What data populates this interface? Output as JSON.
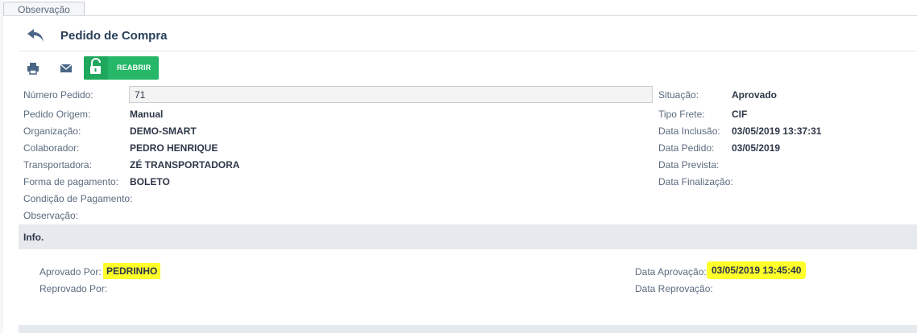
{
  "tab": {
    "label": "Observação"
  },
  "header": {
    "title": "Pedido de Compra"
  },
  "toolbar": {
    "reopen_label": "REABRIR"
  },
  "fields_left": [
    {
      "label": "Número Pedido:",
      "value": "71"
    },
    {
      "label": "Pedido Origem:",
      "value": "Manual"
    },
    {
      "label": "Organização:",
      "value": "DEMO-SMART"
    },
    {
      "label": "Colaborador:",
      "value": "PEDRO HENRIQUE"
    },
    {
      "label": "Transportadora:",
      "value": "ZÉ TRANSPORTADORA"
    },
    {
      "label": "Forma de pagamento:",
      "value": "BOLETO"
    },
    {
      "label": "Condição de Pagamento:",
      "value": ""
    },
    {
      "label": "Observação:",
      "value": ""
    }
  ],
  "fields_right": [
    {
      "label": "Situação:",
      "value": "Aprovado"
    },
    {
      "label": "Tipo Frete:",
      "value": "CIF"
    },
    {
      "label": "Data Inclusão:",
      "value": "03/05/2019 13:37:31"
    },
    {
      "label": "Data Pedido:",
      "value": "03/05/2019"
    },
    {
      "label": "Data Prevista:",
      "value": ""
    },
    {
      "label": "Data Finalização:",
      "value": ""
    }
  ],
  "info": {
    "title": "Info.",
    "approved_by_label": "Aprovado Por:",
    "approved_by_value": "PEDRINHO",
    "rejected_by_label": "Reprovado Por:",
    "approval_date_label": "Data Aprovação:",
    "approval_date_value": "03/05/2019 13:45:40",
    "rejection_date_label": "Data Reprovação:"
  },
  "colors": {
    "accent_green": "#26b768",
    "highlight": "#ffff2a",
    "title": "#29405a"
  }
}
